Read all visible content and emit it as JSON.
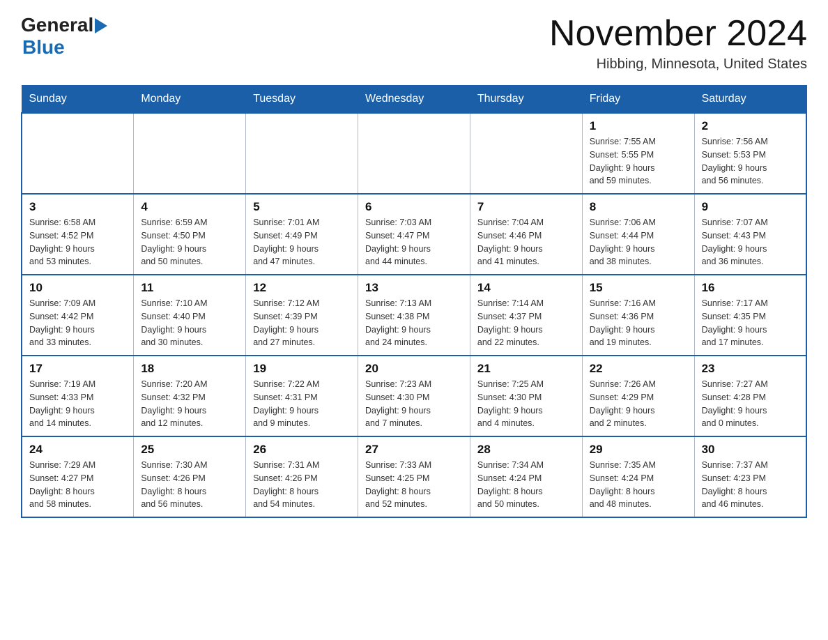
{
  "header": {
    "logo_general": "General",
    "logo_arrow": "▶",
    "logo_blue": "Blue",
    "title": "November 2024",
    "subtitle": "Hibbing, Minnesota, United States"
  },
  "days_of_week": [
    "Sunday",
    "Monday",
    "Tuesday",
    "Wednesday",
    "Thursday",
    "Friday",
    "Saturday"
  ],
  "weeks": [
    [
      {
        "day": "",
        "info": ""
      },
      {
        "day": "",
        "info": ""
      },
      {
        "day": "",
        "info": ""
      },
      {
        "day": "",
        "info": ""
      },
      {
        "day": "",
        "info": ""
      },
      {
        "day": "1",
        "info": "Sunrise: 7:55 AM\nSunset: 5:55 PM\nDaylight: 9 hours\nand 59 minutes."
      },
      {
        "day": "2",
        "info": "Sunrise: 7:56 AM\nSunset: 5:53 PM\nDaylight: 9 hours\nand 56 minutes."
      }
    ],
    [
      {
        "day": "3",
        "info": "Sunrise: 6:58 AM\nSunset: 4:52 PM\nDaylight: 9 hours\nand 53 minutes."
      },
      {
        "day": "4",
        "info": "Sunrise: 6:59 AM\nSunset: 4:50 PM\nDaylight: 9 hours\nand 50 minutes."
      },
      {
        "day": "5",
        "info": "Sunrise: 7:01 AM\nSunset: 4:49 PM\nDaylight: 9 hours\nand 47 minutes."
      },
      {
        "day": "6",
        "info": "Sunrise: 7:03 AM\nSunset: 4:47 PM\nDaylight: 9 hours\nand 44 minutes."
      },
      {
        "day": "7",
        "info": "Sunrise: 7:04 AM\nSunset: 4:46 PM\nDaylight: 9 hours\nand 41 minutes."
      },
      {
        "day": "8",
        "info": "Sunrise: 7:06 AM\nSunset: 4:44 PM\nDaylight: 9 hours\nand 38 minutes."
      },
      {
        "day": "9",
        "info": "Sunrise: 7:07 AM\nSunset: 4:43 PM\nDaylight: 9 hours\nand 36 minutes."
      }
    ],
    [
      {
        "day": "10",
        "info": "Sunrise: 7:09 AM\nSunset: 4:42 PM\nDaylight: 9 hours\nand 33 minutes."
      },
      {
        "day": "11",
        "info": "Sunrise: 7:10 AM\nSunset: 4:40 PM\nDaylight: 9 hours\nand 30 minutes."
      },
      {
        "day": "12",
        "info": "Sunrise: 7:12 AM\nSunset: 4:39 PM\nDaylight: 9 hours\nand 27 minutes."
      },
      {
        "day": "13",
        "info": "Sunrise: 7:13 AM\nSunset: 4:38 PM\nDaylight: 9 hours\nand 24 minutes."
      },
      {
        "day": "14",
        "info": "Sunrise: 7:14 AM\nSunset: 4:37 PM\nDaylight: 9 hours\nand 22 minutes."
      },
      {
        "day": "15",
        "info": "Sunrise: 7:16 AM\nSunset: 4:36 PM\nDaylight: 9 hours\nand 19 minutes."
      },
      {
        "day": "16",
        "info": "Sunrise: 7:17 AM\nSunset: 4:35 PM\nDaylight: 9 hours\nand 17 minutes."
      }
    ],
    [
      {
        "day": "17",
        "info": "Sunrise: 7:19 AM\nSunset: 4:33 PM\nDaylight: 9 hours\nand 14 minutes."
      },
      {
        "day": "18",
        "info": "Sunrise: 7:20 AM\nSunset: 4:32 PM\nDaylight: 9 hours\nand 12 minutes."
      },
      {
        "day": "19",
        "info": "Sunrise: 7:22 AM\nSunset: 4:31 PM\nDaylight: 9 hours\nand 9 minutes."
      },
      {
        "day": "20",
        "info": "Sunrise: 7:23 AM\nSunset: 4:30 PM\nDaylight: 9 hours\nand 7 minutes."
      },
      {
        "day": "21",
        "info": "Sunrise: 7:25 AM\nSunset: 4:30 PM\nDaylight: 9 hours\nand 4 minutes."
      },
      {
        "day": "22",
        "info": "Sunrise: 7:26 AM\nSunset: 4:29 PM\nDaylight: 9 hours\nand 2 minutes."
      },
      {
        "day": "23",
        "info": "Sunrise: 7:27 AM\nSunset: 4:28 PM\nDaylight: 9 hours\nand 0 minutes."
      }
    ],
    [
      {
        "day": "24",
        "info": "Sunrise: 7:29 AM\nSunset: 4:27 PM\nDaylight: 8 hours\nand 58 minutes."
      },
      {
        "day": "25",
        "info": "Sunrise: 7:30 AM\nSunset: 4:26 PM\nDaylight: 8 hours\nand 56 minutes."
      },
      {
        "day": "26",
        "info": "Sunrise: 7:31 AM\nSunset: 4:26 PM\nDaylight: 8 hours\nand 54 minutes."
      },
      {
        "day": "27",
        "info": "Sunrise: 7:33 AM\nSunset: 4:25 PM\nDaylight: 8 hours\nand 52 minutes."
      },
      {
        "day": "28",
        "info": "Sunrise: 7:34 AM\nSunset: 4:24 PM\nDaylight: 8 hours\nand 50 minutes."
      },
      {
        "day": "29",
        "info": "Sunrise: 7:35 AM\nSunset: 4:24 PM\nDaylight: 8 hours\nand 48 minutes."
      },
      {
        "day": "30",
        "info": "Sunrise: 7:37 AM\nSunset: 4:23 PM\nDaylight: 8 hours\nand 46 minutes."
      }
    ]
  ]
}
